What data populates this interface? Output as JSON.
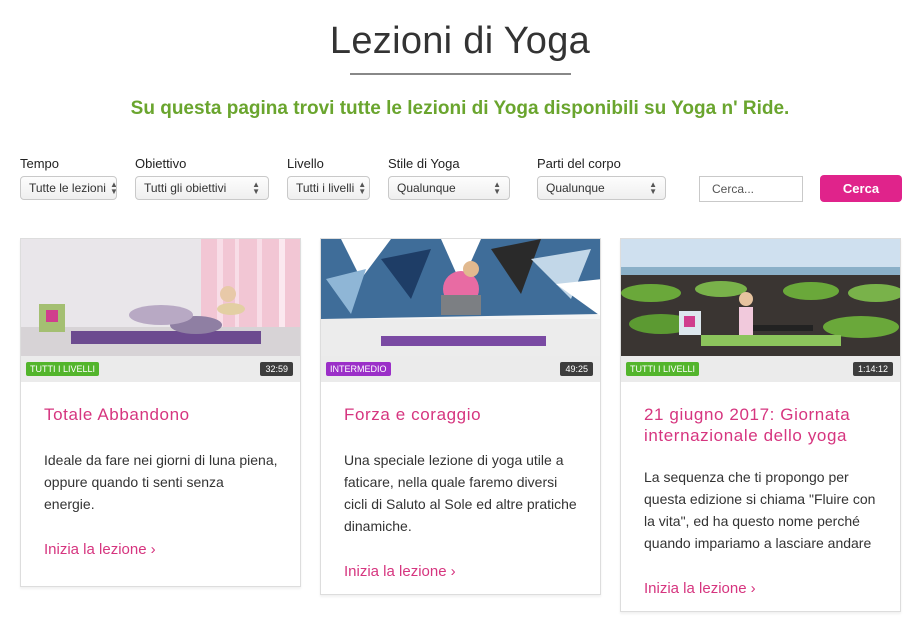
{
  "page": {
    "title": "Lezioni di Yoga",
    "subtitle": "Su questa pagina trovi tutte le lezioni di Yoga disponibili su Yoga n' Ride."
  },
  "filters": [
    {
      "label": "Tempo",
      "value": "Tutte le lezioni"
    },
    {
      "label": "Obiettivo",
      "value": "Tutti gli obiettivi"
    },
    {
      "label": "Livello",
      "value": "Tutti i livelli"
    },
    {
      "label": "Stile di Yoga",
      "value": "Qualunque"
    },
    {
      "label": "Parti del corpo",
      "value": "Qualunque"
    }
  ],
  "search": {
    "placeholder": "Cerca...",
    "button_label": "Cerca"
  },
  "colors": {
    "accent": "#e0238b",
    "title_pink": "#d6357f",
    "subtitle_green": "#6aa52e",
    "badge_green": "#53b52c",
    "badge_purple": "#9b2fc8"
  },
  "cards": [
    {
      "badge": "TUTTI I LIVELLI",
      "duration": "32:59",
      "title": "Totale Abbandono",
      "description": "Ideale da fare nei giorni di luna piena, oppure quando ti senti senza energie.",
      "link_label": "Inizia la lezione",
      "link_chevron": "›"
    },
    {
      "badge": "INTERMEDIO",
      "duration": "49:25",
      "title": "Forza e coraggio",
      "description": "Una speciale lezione di yoga utile a faticare, nella quale faremo diversi cicli di Saluto al Sole ed altre pratiche dinamiche.",
      "link_label": "Inizia la lezione",
      "link_chevron": "›"
    },
    {
      "badge": "TUTTI I LIVELLI",
      "duration": "1:14:12",
      "title": "21 giugno 2017: Giornata internazionale dello yoga",
      "description": "La sequenza che ti propongo per questa edizione si chiama \"Fluire con la vita\", ed ha questo nome perché quando impariamo a lasciare andare",
      "link_label": "Inizia la lezione",
      "link_chevron": "›"
    }
  ]
}
